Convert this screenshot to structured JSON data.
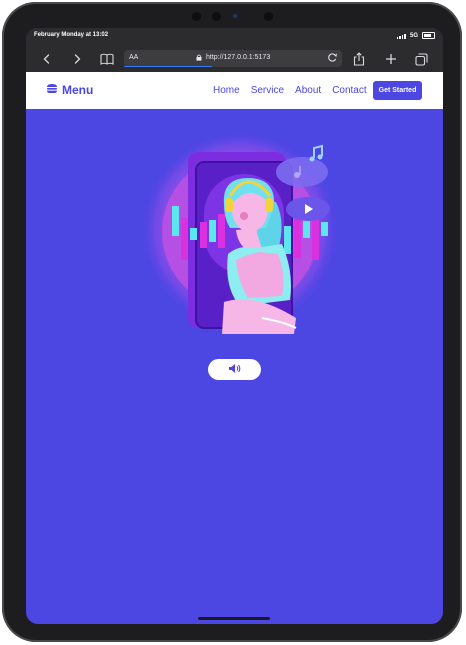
{
  "status": {
    "date": "February Monday at 13:02",
    "network": "5G"
  },
  "browser": {
    "text_size_label": "AA",
    "url": "http://127.0.0.1:5173"
  },
  "navbar": {
    "brand": "Menu",
    "links": [
      "Home",
      "Service",
      "About",
      "Contact"
    ],
    "cta": "Get Started"
  },
  "colors": {
    "accent": "#4c46e3",
    "hero_glow": "#c45ae8",
    "bars_cyan": "#5ee6f0",
    "bars_magenta": "#d931e0"
  },
  "icons": {
    "brand": "hamburger-icon",
    "sound": "speaker-icon",
    "music": "music-note-icon",
    "play": "play-icon"
  }
}
